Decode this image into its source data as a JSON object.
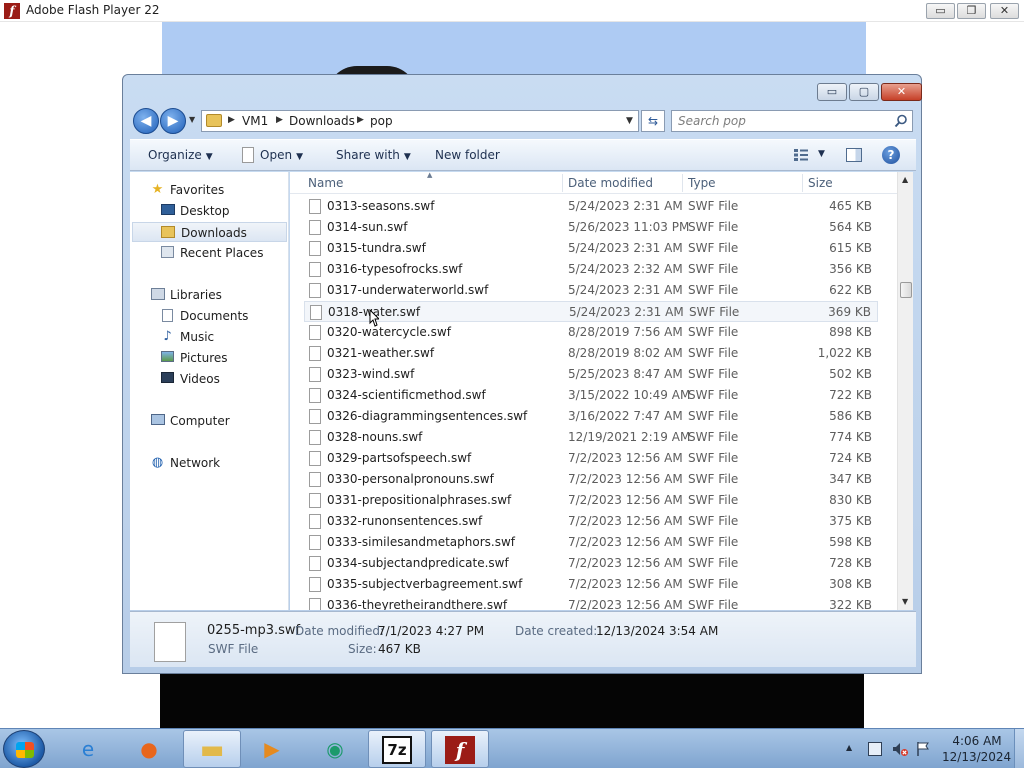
{
  "flash_window": {
    "title": "Adobe Flash Player 22",
    "controls": {
      "minimize": "▭",
      "maximize": "❐",
      "close": "✕"
    }
  },
  "explorer": {
    "controls": {
      "minimize": "▭",
      "maximize": "▢",
      "close": "✕"
    },
    "breadcrumb": [
      "VM1",
      "Downloads",
      "pop"
    ],
    "search": {
      "placeholder": "Search pop"
    },
    "toolbar": {
      "organize": "Organize",
      "open": "Open",
      "share_with": "Share with",
      "new_folder": "New folder"
    },
    "nav_pane": {
      "favorites": {
        "label": "Favorites",
        "items": [
          "Desktop",
          "Downloads",
          "Recent Places"
        ],
        "selected": "Downloads"
      },
      "libraries": {
        "label": "Libraries",
        "items": [
          "Documents",
          "Music",
          "Pictures",
          "Videos"
        ]
      },
      "computer": "Computer",
      "network": "Network"
    },
    "columns": [
      "Name",
      "Date modified",
      "Type",
      "Size"
    ],
    "files": [
      {
        "name": "0313-seasons.swf",
        "date": "5/24/2023 2:31 AM",
        "type": "SWF File",
        "size": "465 KB"
      },
      {
        "name": "0314-sun.swf",
        "date": "5/26/2023 11:03 PM",
        "type": "SWF File",
        "size": "564 KB"
      },
      {
        "name": "0315-tundra.swf",
        "date": "5/24/2023 2:31 AM",
        "type": "SWF File",
        "size": "615 KB"
      },
      {
        "name": "0316-typesofrocks.swf",
        "date": "5/24/2023 2:32 AM",
        "type": "SWF File",
        "size": "356 KB"
      },
      {
        "name": "0317-underwaterworld.swf",
        "date": "5/24/2023 2:31 AM",
        "type": "SWF File",
        "size": "622 KB"
      },
      {
        "name": "0318-water.swf",
        "date": "5/24/2023 2:31 AM",
        "type": "SWF File",
        "size": "369 KB"
      },
      {
        "name": "0320-watercycle.swf",
        "date": "8/28/2019 7:56 AM",
        "type": "SWF File",
        "size": "898 KB"
      },
      {
        "name": "0321-weather.swf",
        "date": "8/28/2019 8:02 AM",
        "type": "SWF File",
        "size": "1,022 KB"
      },
      {
        "name": "0323-wind.swf",
        "date": "5/25/2023 8:47 AM",
        "type": "SWF File",
        "size": "502 KB"
      },
      {
        "name": "0324-scientificmethod.swf",
        "date": "3/15/2022 10:49 AM",
        "type": "SWF File",
        "size": "722 KB"
      },
      {
        "name": "0326-diagrammingsentences.swf",
        "date": "3/16/2022 7:47 AM",
        "type": "SWF File",
        "size": "586 KB"
      },
      {
        "name": "0328-nouns.swf",
        "date": "12/19/2021 2:19 AM",
        "type": "SWF File",
        "size": "774 KB"
      },
      {
        "name": "0329-partsofspeech.swf",
        "date": "7/2/2023 12:56 AM",
        "type": "SWF File",
        "size": "724 KB"
      },
      {
        "name": "0330-personalpronouns.swf",
        "date": "7/2/2023 12:56 AM",
        "type": "SWF File",
        "size": "347 KB"
      },
      {
        "name": "0331-prepositionalphrases.swf",
        "date": "7/2/2023 12:56 AM",
        "type": "SWF File",
        "size": "830 KB"
      },
      {
        "name": "0332-runonsentences.swf",
        "date": "7/2/2023 12:56 AM",
        "type": "SWF File",
        "size": "375 KB"
      },
      {
        "name": "0333-similesandmetaphors.swf",
        "date": "7/2/2023 12:56 AM",
        "type": "SWF File",
        "size": "598 KB"
      },
      {
        "name": "0334-subjectandpredicate.swf",
        "date": "7/2/2023 12:56 AM",
        "type": "SWF File",
        "size": "728 KB"
      },
      {
        "name": "0335-subjectverbagreement.swf",
        "date": "7/2/2023 12:56 AM",
        "type": "SWF File",
        "size": "308 KB"
      },
      {
        "name": "0336-theyretheirandthere.swf",
        "date": "7/2/2023 12:56 AM",
        "type": "SWF File",
        "size": "322 KB"
      }
    ],
    "hovered_row": 5,
    "details": {
      "file_name": "0255-mp3.swf",
      "file_type": "SWF File",
      "date_modified_label": "Date modified:",
      "date_modified": "7/1/2023 4:27 PM",
      "size_label": "Size:",
      "size": "467 KB",
      "date_created_label": "Date created:",
      "date_created": "12/13/2024 3:54 AM"
    }
  },
  "taskbar": {
    "apps": [
      {
        "name": "internet-explorer",
        "glyph": "e",
        "color": "#2a7fd4",
        "active": false
      },
      {
        "name": "firefox",
        "glyph": "●",
        "color": "#e8661c",
        "active": false
      },
      {
        "name": "file-explorer",
        "glyph": "▬",
        "color": "#e2b94a",
        "active": true
      },
      {
        "name": "media-player",
        "glyph": "▶",
        "color": "#e58a1f",
        "active": false
      },
      {
        "name": "green-app",
        "glyph": "◉",
        "color": "#1c9a6b",
        "active": false
      },
      {
        "name": "7zip",
        "glyph": "7z",
        "color": "#111111",
        "active": true
      },
      {
        "name": "flash-player",
        "glyph": "f",
        "color": "#9b1c16",
        "active": true
      }
    ],
    "tray": {
      "time": "4:06 AM",
      "date": "12/13/2024"
    }
  }
}
